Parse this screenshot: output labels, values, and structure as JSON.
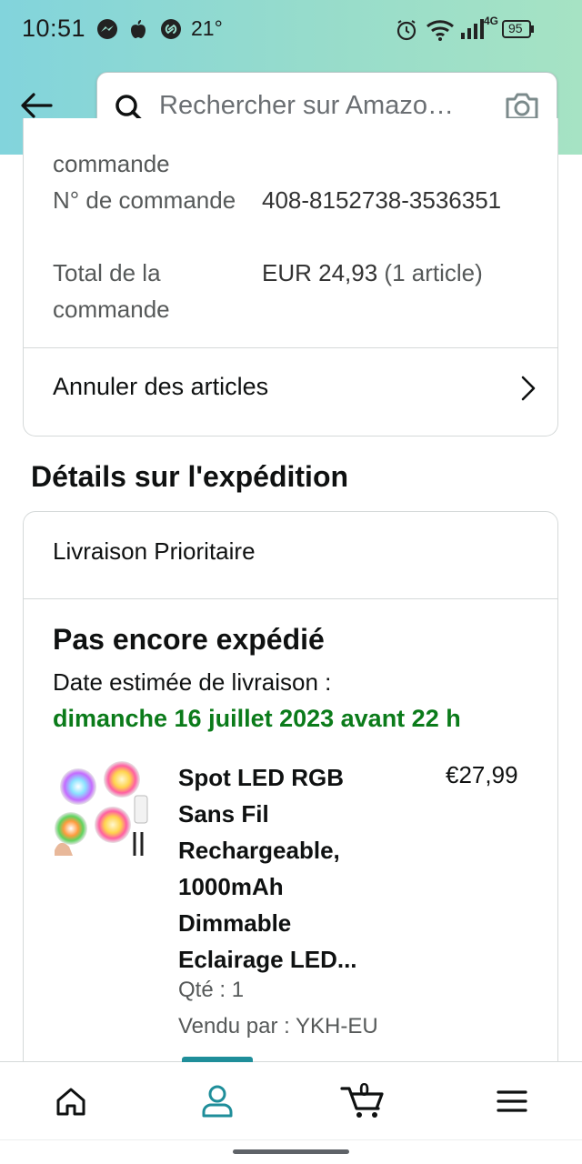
{
  "status_bar": {
    "time": "10:51",
    "temperature": "21°",
    "battery": "95",
    "network": "4G"
  },
  "header": {
    "search_placeholder": "Rechercher sur Amazo…"
  },
  "order_info": {
    "partial_label": "commande",
    "order_number_label": "N° de commande",
    "order_number_value": "408-8152738-3536351",
    "total_label": "Total de la commande",
    "total_value": "EUR 24,93",
    "total_items": "(1 article)",
    "cancel_label": "Annuler des articles"
  },
  "shipping": {
    "section_title": "Détails sur l'expédition",
    "shipping_speed": "Livraison Prioritaire",
    "status": "Pas encore expédié",
    "estimate_label": "Date estimée de livraison :",
    "estimate_date": "dimanche 16 juillet 2023 avant 22 h",
    "item": {
      "name": "Spot LED RGB Sans Fil Rechargeable, 1000mAh Dimmable Eclairage LED...",
      "price": "€27,99",
      "quantity": "Qté : 1",
      "seller": "Vendu par : YKH-EU"
    }
  },
  "bottom_nav": {
    "cart_count": "0",
    "active_tab": "account"
  },
  "colors": {
    "accent_teal": "#1f8e9a",
    "delivery_green": "#0b7b1a",
    "header_gradient_start": "#82d4dc",
    "header_gradient_end": "#a6e3c4"
  }
}
